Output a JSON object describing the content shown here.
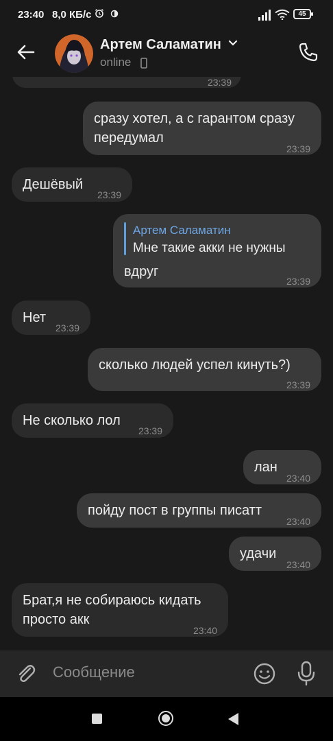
{
  "status_bar": {
    "time": "23:40",
    "speed": "8,0 КБ/с",
    "battery": "45"
  },
  "header": {
    "name": "Артем Саламатин",
    "status": "online"
  },
  "messages": [
    {
      "dir": "in",
      "text": "",
      "time": "23:39"
    },
    {
      "dir": "out",
      "lines": [
        "сразу хотел, а с гарантом сразу",
        "передумал"
      ],
      "time": "23:39"
    },
    {
      "dir": "in",
      "text": "Дешёвый",
      "time": "23:39"
    },
    {
      "dir": "out",
      "reply_name": "Артем Саламатин",
      "reply_text": "Мне такие акки не нужны",
      "text": "вдруг",
      "time": "23:39"
    },
    {
      "dir": "in",
      "text": "Нет",
      "time": "23:39"
    },
    {
      "dir": "out",
      "text": "сколько людей успел кинуть?)",
      "time": "23:39"
    },
    {
      "dir": "in",
      "text": "Не сколько лол",
      "time": "23:39"
    },
    {
      "dir": "out",
      "text": "лан",
      "time": "23:40"
    },
    {
      "dir": "out",
      "text": "пойду пост в группы писатт",
      "time": "23:40"
    },
    {
      "dir": "out",
      "text": "удачи",
      "time": "23:40"
    },
    {
      "dir": "in",
      "lines": [
        "Брат,я не собираюсь кидать",
        "просто акк"
      ],
      "time": "23:40"
    }
  ],
  "input": {
    "placeholder": "Сообщение"
  },
  "colors": {
    "background": "#191919",
    "bubble_out": "#3a3a3a",
    "bubble_in": "#2b2b2b",
    "reply_accent": "#6ea6e4"
  },
  "icons": [
    "back-arrow-icon",
    "chevron-down-icon",
    "phone-icon",
    "paperclip-icon",
    "emoji-icon",
    "microphone-icon",
    "recents-icon",
    "home-icon",
    "nav-back-icon"
  ]
}
